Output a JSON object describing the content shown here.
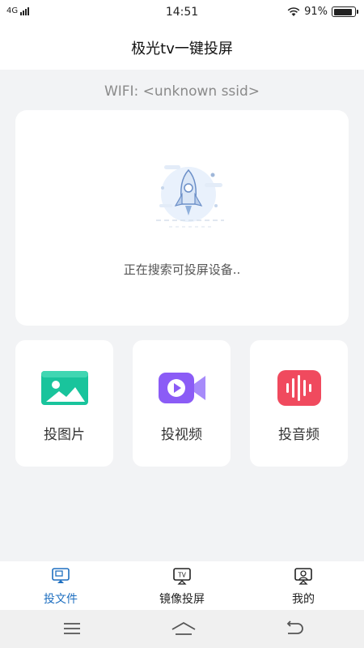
{
  "status_bar": {
    "network": "4G",
    "time": "14:51",
    "battery_percent": "91%",
    "battery_level": 0.91
  },
  "header": {
    "title": "极光tv一键投屏"
  },
  "wifi": {
    "label": "WIFI: <unknown ssid>"
  },
  "search": {
    "status_text": "正在搜索可投屏设备.."
  },
  "features": [
    {
      "label": "投图片",
      "icon": "image-icon",
      "color": "#19c49c"
    },
    {
      "label": "投视频",
      "icon": "video-camera-icon",
      "color": "#8b5cf6"
    },
    {
      "label": "投音频",
      "icon": "audio-wave-icon",
      "color": "#f04a5e"
    }
  ],
  "tabs": [
    {
      "label": "投文件",
      "icon": "cast-file-icon",
      "active": true
    },
    {
      "label": "镜像投屏",
      "icon": "tv-mirror-icon",
      "active": false
    },
    {
      "label": "我的",
      "icon": "profile-icon",
      "active": false
    }
  ],
  "system_nav": {
    "icons": [
      "menu-icon",
      "home-icon",
      "back-icon"
    ]
  },
  "colors": {
    "accent": "#1e6fc0",
    "background": "#f2f3f5"
  }
}
